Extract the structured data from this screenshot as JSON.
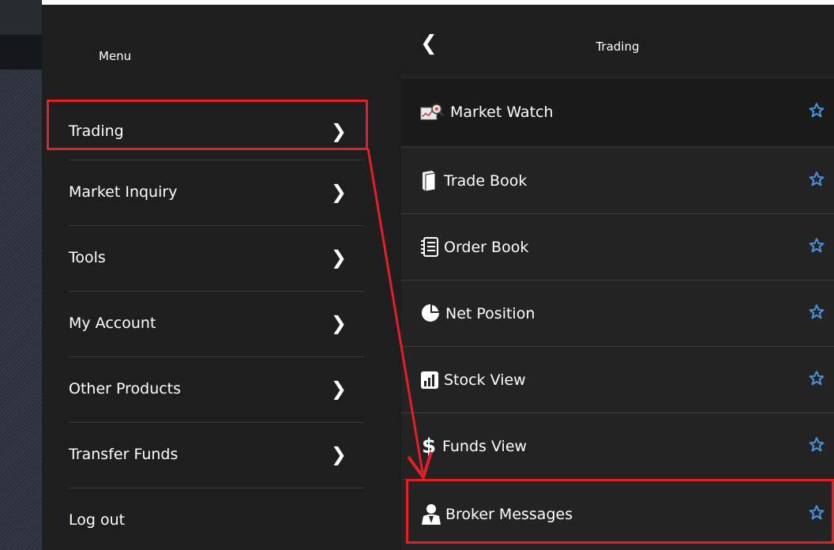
{
  "menu": {
    "title": "Menu",
    "items": [
      {
        "label": "Trading",
        "has_submenu": true
      },
      {
        "label": "Market Inquiry",
        "has_submenu": true
      },
      {
        "label": "Tools",
        "has_submenu": true
      },
      {
        "label": "My Account",
        "has_submenu": true
      },
      {
        "label": "Other Products",
        "has_submenu": true
      },
      {
        "label": "Transfer Funds",
        "has_submenu": true
      },
      {
        "label": "Log out",
        "has_submenu": false
      }
    ]
  },
  "submenu": {
    "title": "Trading",
    "back_icon": "chevron-left-icon",
    "items": [
      {
        "label": "Market Watch",
        "icon": "market-watch-icon"
      },
      {
        "label": "Trade Book",
        "icon": "trade-book-icon"
      },
      {
        "label": "Order Book",
        "icon": "order-book-icon"
      },
      {
        "label": "Net Position",
        "icon": "net-position-icon"
      },
      {
        "label": "Stock View",
        "icon": "stock-view-icon"
      },
      {
        "label": "Funds View",
        "icon": "funds-view-icon"
      },
      {
        "label": "Broker Messages",
        "icon": "broker-messages-icon"
      }
    ]
  },
  "annotations": {
    "highlight_color": "#e41e26",
    "highlighted_menu_item": "Trading",
    "highlighted_submenu_item": "Broker Messages"
  },
  "colors": {
    "panel_bg": "#1e1e1e",
    "text": "#ffffff",
    "star": "#4a90d9"
  }
}
